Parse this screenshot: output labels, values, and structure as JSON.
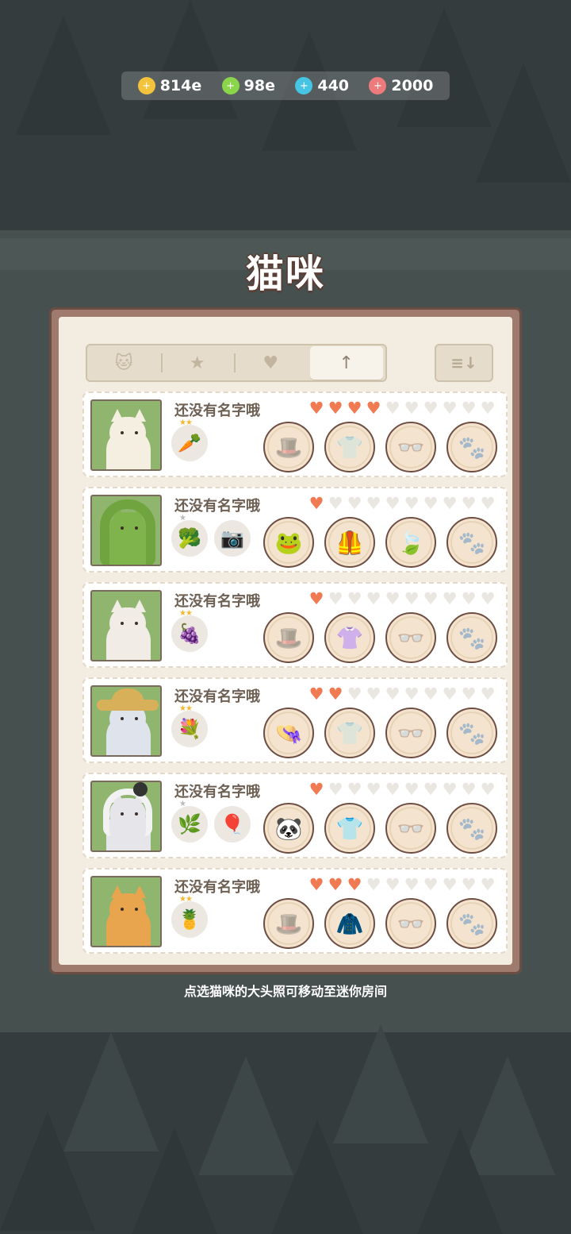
{
  "currency": [
    {
      "icon": "gold-coin-icon",
      "value": "814e",
      "color": "#f3c33b"
    },
    {
      "icon": "energy-bolt-icon",
      "value": "98e",
      "color": "#8bd54a"
    },
    {
      "icon": "gem-icon",
      "value": "440",
      "color": "#46c4e3"
    },
    {
      "icon": "cat-food-icon",
      "value": "2000",
      "color": "#ee7b7b"
    }
  ],
  "title": "猫咪",
  "tabs": [
    {
      "icon": "cat-head-icon",
      "glyph": "🐱"
    },
    {
      "icon": "star-icon",
      "glyph": "★"
    },
    {
      "icon": "heart-icon",
      "glyph": "♥"
    },
    {
      "icon": "arrow-up-icon",
      "glyph": "↑",
      "active": true
    }
  ],
  "sort": {
    "icon": "sort-icon",
    "glyph": "≡↓"
  },
  "cats": [
    {
      "name": "还没有名字哦",
      "hearts_on": 4,
      "hearts_total": 10,
      "fur": "#f5efe2",
      "hat": "none",
      "items": [
        {
          "icon": "carrot-icon",
          "glyph": "🥕",
          "stars": "★★"
        }
      ],
      "slots": [
        {
          "icon": "hat-slot-icon",
          "glyph": "🎩",
          "filled": false
        },
        {
          "icon": "shirt-slot-icon",
          "glyph": "👕",
          "filled": false
        },
        {
          "icon": "glasses-slot-icon",
          "glyph": "👓",
          "filled": false
        },
        {
          "icon": "face-slot-icon",
          "glyph": "🐾",
          "filled": false
        }
      ]
    },
    {
      "name": "还没有名字哦",
      "hearts_on": 1,
      "hearts_total": 10,
      "fur": "#7fb34c",
      "hat": "frog",
      "items": [
        {
          "icon": "broccoli-icon",
          "glyph": "🥦",
          "stars": "★"
        },
        {
          "icon": "camera-icon",
          "glyph": "📷",
          "stars": ""
        }
      ],
      "slots": [
        {
          "icon": "frog-hood-icon",
          "glyph": "🐸",
          "filled": true
        },
        {
          "icon": "green-vest-icon",
          "glyph": "🦺",
          "filled": true
        },
        {
          "icon": "leaf-icon",
          "glyph": "🍃",
          "filled": true
        },
        {
          "icon": "face-slot-icon",
          "glyph": "🐾",
          "filled": false
        }
      ]
    },
    {
      "name": "还没有名字哦",
      "hearts_on": 1,
      "hearts_total": 10,
      "fur": "#f1ede6",
      "hat": "none",
      "items": [
        {
          "icon": "mangosteen-icon",
          "glyph": "🍇",
          "stars": "★★"
        }
      ],
      "slots": [
        {
          "icon": "hat-slot-icon",
          "glyph": "🎩",
          "filled": false
        },
        {
          "icon": "yellow-top-icon",
          "glyph": "👚",
          "filled": true
        },
        {
          "icon": "glasses-slot-icon",
          "glyph": "👓",
          "filled": false
        },
        {
          "icon": "face-slot-icon",
          "glyph": "🐾",
          "filled": false
        }
      ]
    },
    {
      "name": "还没有名字哦",
      "hearts_on": 2,
      "hearts_total": 10,
      "fur": "#dfe4ec",
      "hat": "straw",
      "items": [
        {
          "icon": "flower-bouquet-icon",
          "glyph": "💐",
          "stars": "★★"
        }
      ],
      "slots": [
        {
          "icon": "straw-hat-icon",
          "glyph": "👒",
          "filled": true
        },
        {
          "icon": "shirt-slot-icon",
          "glyph": "👕",
          "filled": false
        },
        {
          "icon": "glasses-slot-icon",
          "glyph": "👓",
          "filled": false
        },
        {
          "icon": "face-slot-icon",
          "glyph": "🐾",
          "filled": false
        }
      ]
    },
    {
      "name": "还没有名字哦",
      "hearts_on": 1,
      "hearts_total": 10,
      "fur": "#e6e6ea",
      "hat": "panda",
      "items": [
        {
          "icon": "herb-bundle-icon",
          "glyph": "🌿",
          "stars": "★"
        },
        {
          "icon": "hot-air-balloon-icon",
          "glyph": "🎈",
          "stars": ""
        }
      ],
      "slots": [
        {
          "icon": "panda-hood-icon",
          "glyph": "🐼",
          "filled": true
        },
        {
          "icon": "top-shirt-icon",
          "glyph": "👕",
          "filled": true
        },
        {
          "icon": "glasses-slot-icon",
          "glyph": "👓",
          "filled": false
        },
        {
          "icon": "face-slot-icon",
          "glyph": "🐾",
          "filled": false
        }
      ]
    },
    {
      "name": "还没有名字哦",
      "hearts_on": 3,
      "hearts_total": 10,
      "fur": "#e8a54e",
      "hat": "none",
      "items": [
        {
          "icon": "pineapple-icon",
          "glyph": "🍍",
          "stars": "★★"
        }
      ],
      "slots": [
        {
          "icon": "hat-slot-icon",
          "glyph": "🎩",
          "filled": false
        },
        {
          "icon": "red-jacket-icon",
          "glyph": "🧥",
          "filled": true
        },
        {
          "icon": "glasses-slot-icon",
          "glyph": "👓",
          "filled": false
        },
        {
          "icon": "face-slot-icon",
          "glyph": "🐾",
          "filled": false
        }
      ]
    }
  ],
  "hint": "点选猫咪的大头照可移动至迷你房间"
}
